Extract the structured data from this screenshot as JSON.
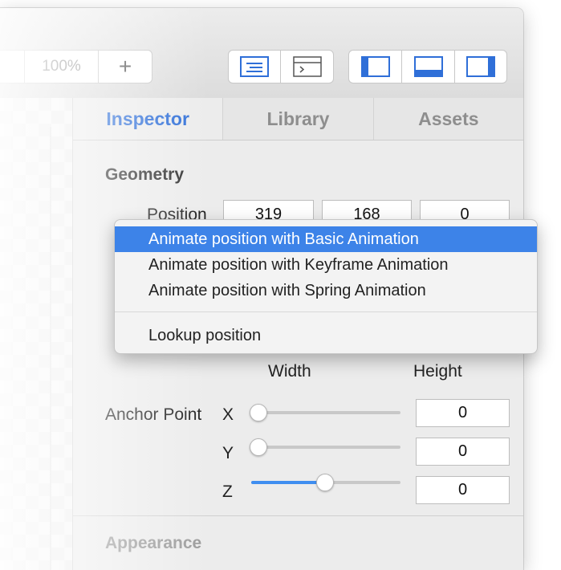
{
  "toolbar": {
    "zoom_label": "100%",
    "add_label": "+"
  },
  "tabs": [
    {
      "label": "Inspector",
      "active": true
    },
    {
      "label": "Library",
      "active": false
    },
    {
      "label": "Assets",
      "active": false
    }
  ],
  "geometry": {
    "title": "Geometry",
    "position_label": "Position",
    "position": {
      "x": "319",
      "y": "168",
      "z": "0"
    },
    "width_label": "Width",
    "height_label": "Height",
    "anchor_label": "Anchor Point",
    "anchor": [
      {
        "axis": "X",
        "value": "0",
        "slider": 0.0
      },
      {
        "axis": "Y",
        "value": "0",
        "slider": 0.0
      },
      {
        "axis": "Z",
        "value": "0",
        "slider": 0.5
      }
    ]
  },
  "appearance": {
    "title": "Appearance"
  },
  "context_menu": {
    "items": [
      {
        "label": "Animate position with Basic Animation",
        "highlighted": true
      },
      {
        "label": "Animate position with Keyframe Animation",
        "highlighted": false
      },
      {
        "label": "Animate position with Spring Animation",
        "highlighted": false
      }
    ],
    "lookup_label": "Lookup position"
  },
  "colors": {
    "accent": "#2f6fd8",
    "menu_highlight": "#3d83e8",
    "slider_fill": "#3f8ef0"
  }
}
